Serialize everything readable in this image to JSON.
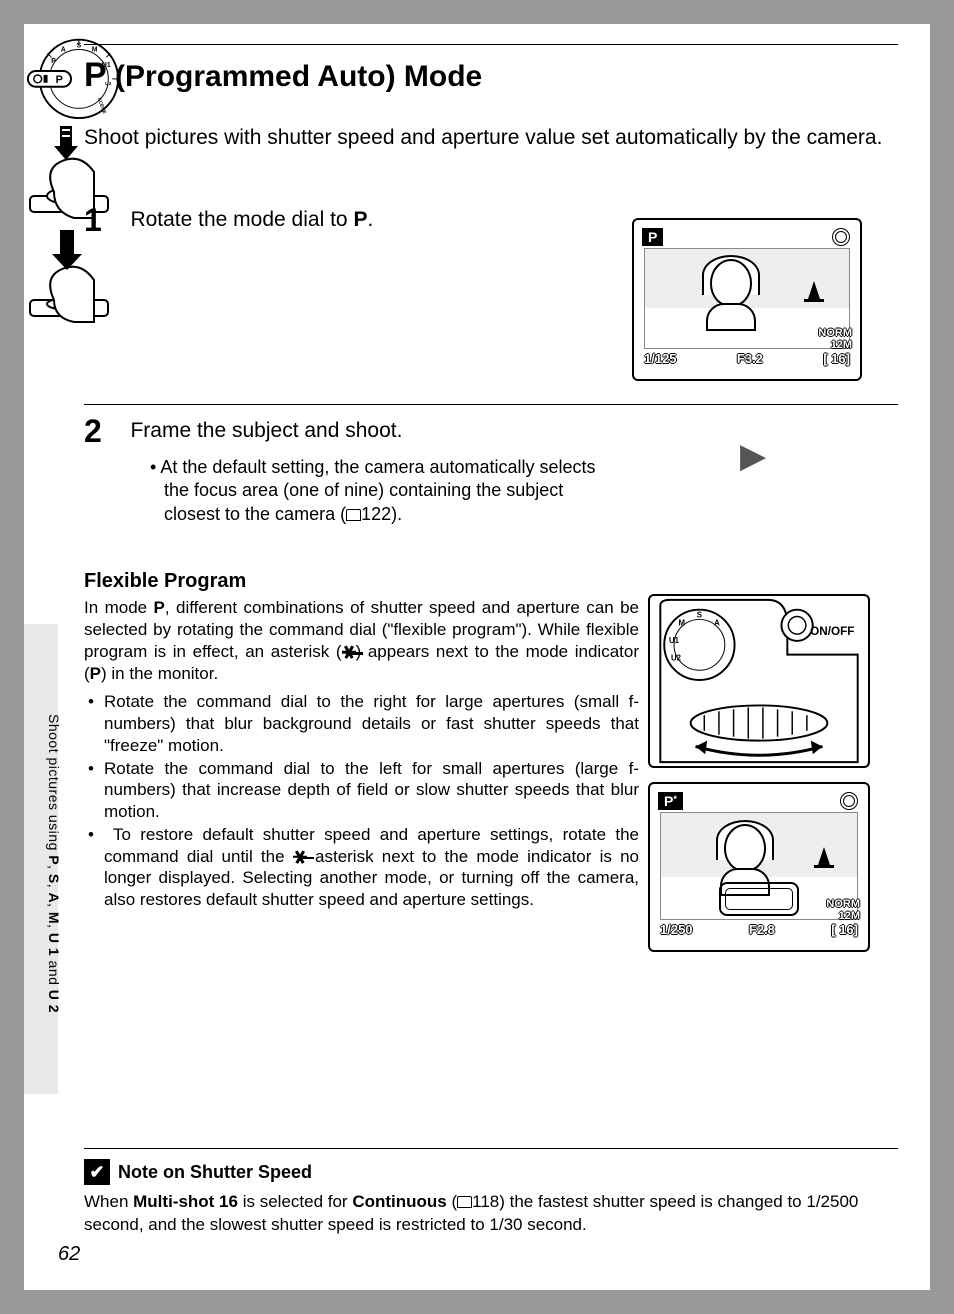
{
  "title_prefix": "P",
  "title_rest": " (Programmed Auto) Mode",
  "intro": "Shoot pictures with shutter speed and aperture value set automatically by the camera.",
  "step1": {
    "num": "1",
    "text_a": "Rotate the mode dial to ",
    "text_b": "P",
    "text_c": "."
  },
  "step2": {
    "num": "2",
    "text": "Frame the subject and shoot.",
    "bullet_a": "At the default setting, the camera automatically selects the focus area (one of nine) containing the subject closest to the camera (",
    "bullet_ref": "122",
    "bullet_b": ")."
  },
  "flexible": {
    "heading": "Flexible Program",
    "p1_a": "In mode ",
    "p1_b": "P",
    "p1_c": ", different combinations of shutter speed and aperture can be selected by rotating the command dial (\"flexible program\"). While flexible program is in effect, an asterisk (",
    "p1_d": ") appears next to the mode indicator (",
    "p1_e": "P",
    "p1_f": ") in the monitor.",
    "li1": "Rotate the command dial to the right for large apertures (small f-numbers) that blur background details or fast shutter speeds that \"freeze\" motion.",
    "li2": "Rotate the command dial to the left for small apertures (large f-numbers) that increase depth of field or slow shutter speeds that blur motion.",
    "li3_a": "To restore default shutter speed and aperture settings, rotate the command dial until the ",
    "li3_b": " asterisk next to the mode indicator is no longer displayed. Selecting another mode, or turning off the camera, also restores default shutter speed and aperture settings."
  },
  "side_label": {
    "a": "Shoot pictures using ",
    "b": "P",
    "c": ", ",
    "d": "S",
    "e": ", ",
    "f": "A",
    "g": ", ",
    "h": "M",
    "i": ", ",
    "j": "U 1",
    "k": " and ",
    "l": "U 2"
  },
  "note": {
    "heading": "Note on Shutter Speed",
    "body_a": "When ",
    "body_b": "Multi-shot 16",
    "body_c": " is selected for ",
    "body_d": "Continuous",
    "body_e": " (",
    "body_ref": "118",
    "body_f": ") the fastest shutter speed is changed to 1/2500 second, and the slowest shutter speed is restricted to 1/30 second."
  },
  "page_number": "62",
  "lcd1": {
    "mode": "P",
    "shutter": "1/125",
    "aperture": "F3.2",
    "quality": "NORM",
    "size": "12M",
    "remaining": "[   16]"
  },
  "lcd2": {
    "mode": "P",
    "ast": "*",
    "shutter": "1/250",
    "aperture": "F2.8",
    "quality": "NORM",
    "size": "12M",
    "remaining": "[   16]"
  },
  "dial_label": "ON/OFF",
  "mode_dial_marks": "P A S M U1 U2 SCENE"
}
